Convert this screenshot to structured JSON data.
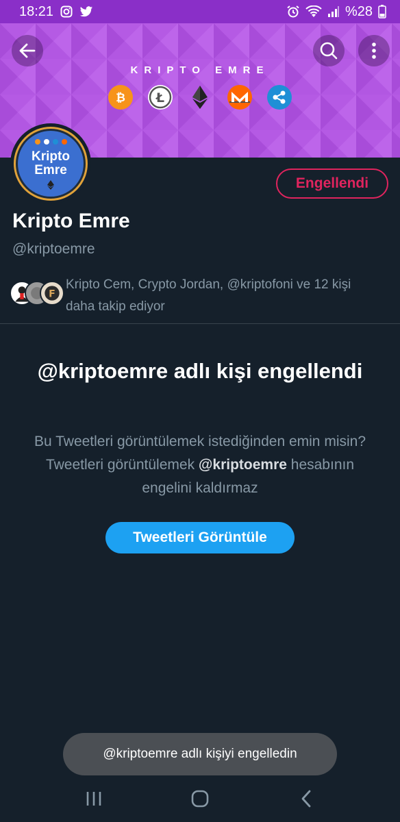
{
  "status_bar": {
    "time": "18:21",
    "battery_text": "%28",
    "icons": [
      "instagram-icon",
      "twitter-icon",
      "alarm-icon",
      "wifi-icon",
      "signal-icon",
      "battery-icon"
    ]
  },
  "banner": {
    "title": "KRIPTO  EMRE",
    "coins": [
      "bitcoin-icon",
      "litecoin-icon",
      "ethereum-icon",
      "monero-icon",
      "ripple-icon"
    ],
    "background_color": "#b257e2"
  },
  "avatar": {
    "line1": "Kripto",
    "line2": "Emre"
  },
  "profile": {
    "blocked_label": "Engellendi",
    "display_name": "Kripto Emre",
    "handle": "@kriptoemre",
    "followed_by": "Kripto Cem, Crypto Jordan, @kriptofoni ve 12 kişi daha takip ediyor"
  },
  "blocked_notice": {
    "heading": "@kriptoemre adlı kişi engellendi",
    "desc_part1": "Bu Tweetleri görüntülemek istediğinden emin misin? Tweetleri görüntülemek ",
    "desc_handle": "@kriptoemre",
    "desc_part2": " hesabının engelini kaldırmaz",
    "view_button": "Tweetleri Görüntüle"
  },
  "toast": {
    "text": "@kriptoemre adlı kişiyi engelledin"
  },
  "colors": {
    "accent_blue": "#1da1f2",
    "blocked_red": "#e0245e",
    "background": "#15202b",
    "muted_text": "#8899a6"
  }
}
